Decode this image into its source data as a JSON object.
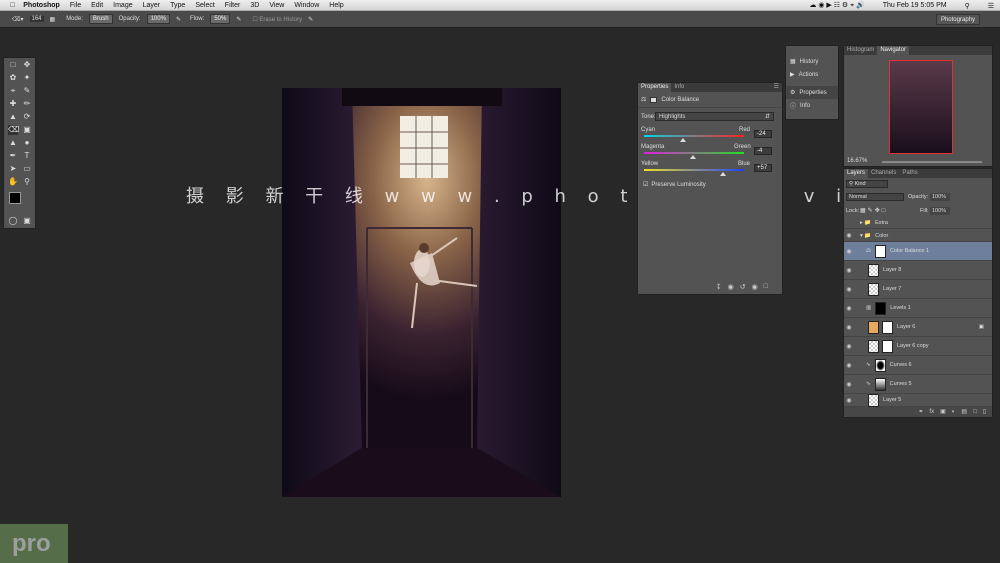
{
  "menubar": {
    "app": "Photoshop",
    "items": [
      "File",
      "Edit",
      "Image",
      "Layer",
      "Type",
      "Select",
      "Filter",
      "3D",
      "View",
      "Window",
      "Help"
    ],
    "datetime": "Thu Feb 19  5:05 PM"
  },
  "options": {
    "brush_size": "164",
    "mode_label": "Mode:",
    "mode_value": "Brush",
    "opacity_label": "Opacity:",
    "opacity_value": "100%",
    "flow_label": "Flow:",
    "flow_value": "50%",
    "erase_history": "Erase to History",
    "workspace": "Photography"
  },
  "watermark": "摄 影 新 干 线   w w w . p h o t o s k s . v i p",
  "properties": {
    "tabs": [
      "Properties",
      "Info"
    ],
    "title": "Color Balance",
    "tone_label": "Tone:",
    "tone_value": "Highlights",
    "sliders": [
      {
        "left": "Cyan",
        "right": "Red",
        "value": "-24"
      },
      {
        "left": "Magenta",
        "right": "Green",
        "value": "-4"
      },
      {
        "left": "Yellow",
        "right": "Blue",
        "value": "+57"
      }
    ],
    "preserve": "Preserve Luminosity"
  },
  "side": {
    "items": [
      "History",
      "Actions",
      "Properties",
      "Info"
    ]
  },
  "navigator": {
    "tabs": [
      "Histogram",
      "Navigator"
    ],
    "zoom": "16.67%"
  },
  "layers": {
    "tabs": [
      "Layers",
      "Channels",
      "Paths"
    ],
    "filter": "Kind",
    "blend": "Normal",
    "opacity_label": "Opacity:",
    "opacity_value": "100%",
    "lock_label": "Lock:",
    "fill_label": "Fill:",
    "fill_value": "100%",
    "groups": [
      "Extra",
      "Color"
    ],
    "rows": [
      "Color Balance 1",
      "Layer 8",
      "Layer 7",
      "Levels 1",
      "Layer 6",
      "Layer 6 copy",
      "Curves 6",
      "Curves 5",
      "Layer 5"
    ]
  },
  "badge": "pro"
}
